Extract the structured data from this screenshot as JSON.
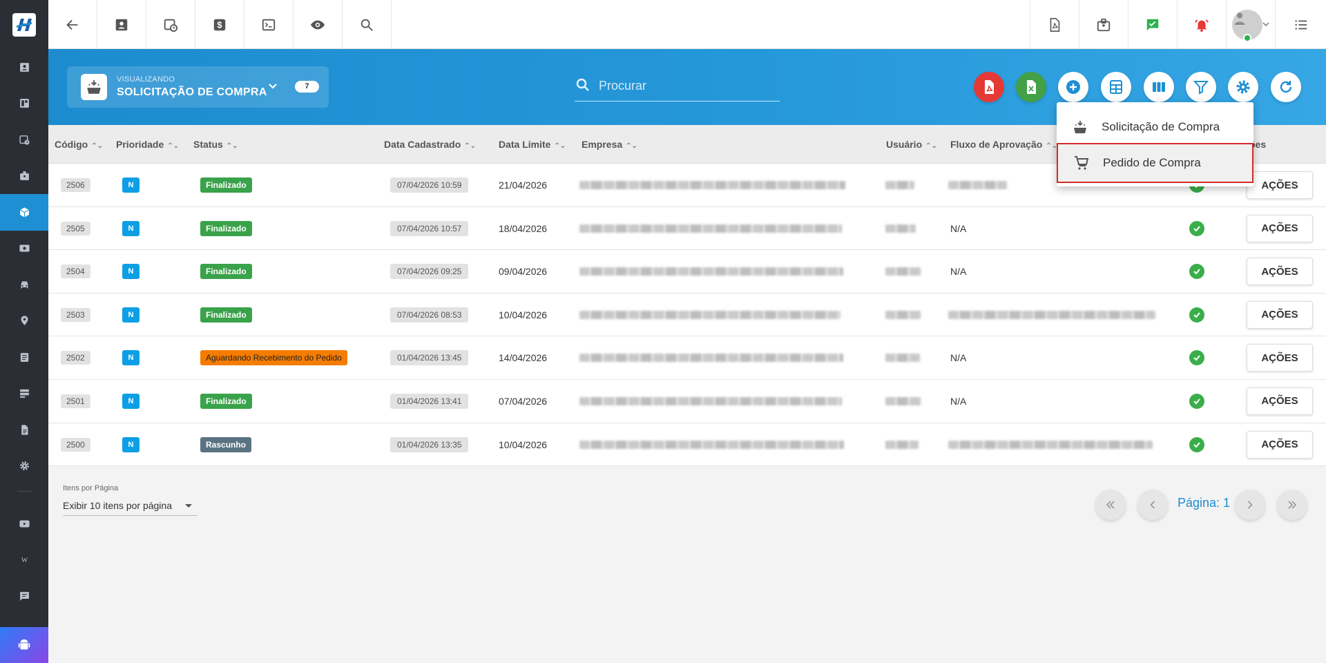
{
  "header": {
    "viewing_label": "VISUALIZANDO",
    "module_title": "SOLICITAÇÃO DE COMPRA",
    "count_badge": "7",
    "search_placeholder": "Procurar"
  },
  "table": {
    "columns": [
      "Código",
      "Prioridade",
      "Status",
      "Data Cadastrado",
      "Data Limite",
      "Empresa",
      "Usuário",
      "Fluxo de Aprovação",
      "ões"
    ],
    "rows": [
      {
        "code": "2506",
        "priority": "N",
        "status": "Finalizado",
        "status_color": "#3aa24a",
        "created": "07/04/2026 10:59",
        "deadline": "21/04/2026",
        "flow": ""
      },
      {
        "code": "2505",
        "priority": "N",
        "status": "Finalizado",
        "status_color": "#3aa24a",
        "created": "07/04/2026 10:57",
        "deadline": "18/04/2026",
        "flow": "N/A"
      },
      {
        "code": "2504",
        "priority": "N",
        "status": "Finalizado",
        "status_color": "#3aa24a",
        "created": "07/04/2026 09:25",
        "deadline": "09/04/2026",
        "flow": "N/A"
      },
      {
        "code": "2503",
        "priority": "N",
        "status": "Finalizado",
        "status_color": "#3aa24a",
        "created": "07/04/2026 08:53",
        "deadline": "10/04/2026",
        "flow": ""
      },
      {
        "code": "2502",
        "priority": "N",
        "status": "Aguardando Recebimento do Pedido",
        "status_color": "#f57c00",
        "created": "01/04/2026 13:45",
        "deadline": "14/04/2026",
        "flow": "N/A"
      },
      {
        "code": "2501",
        "priority": "N",
        "status": "Finalizado",
        "status_color": "#3aa24a",
        "created": "01/04/2026 13:41",
        "deadline": "07/04/2026",
        "flow": "N/A"
      },
      {
        "code": "2500",
        "priority": "N",
        "status": "Rascunho",
        "status_color": "#5a7383",
        "created": "01/04/2026 13:35",
        "deadline": "10/04/2026",
        "flow": ""
      }
    ],
    "actions_label": "AÇÕES"
  },
  "pagination": {
    "items_per_page_label": "Itens por Página",
    "items_per_page_value": "Exibir 10 itens por página",
    "page_text": "Página: 1"
  },
  "dropdown_menu": {
    "items": [
      "Solicitação de Compra",
      "Pedido de Compra"
    ]
  },
  "colors": {
    "accent": "#1d8ccf",
    "sidebar": "#2b2f35",
    "pdf_button": "#e53935",
    "excel_button": "#43a047",
    "highlight_border": "#d42a2a"
  }
}
